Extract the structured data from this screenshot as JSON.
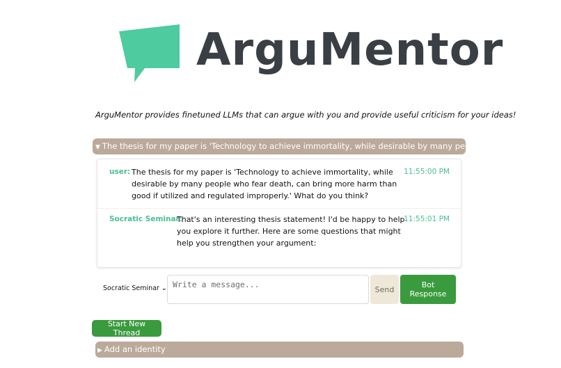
{
  "app": {
    "name": "ArguMentor",
    "tagline": "ArguMentor provides finetuned LLMs that can argue with you and provide useful criticism for your ideas!",
    "brand_color": "#4ecb9f",
    "text_color": "#3a3f45"
  },
  "thread": {
    "toggle_icon": "▼",
    "title": "The thesis for my paper is 'Technology to achieve immortality, while desirable by many people who fe..."
  },
  "messages": [
    {
      "sender": "user:",
      "text": "The thesis for my paper is 'Technology to achieve immortality, while desirable by many people who fear death, can bring more harm than good if utilized and regulated improperly.' What do you think?",
      "time": "11:55:00 PM"
    },
    {
      "sender": "Socratic Seminar:",
      "text": "That's an interesting thesis statement! I'd be happy to help you explore it further. Here are some questions that might help you strengthen your argument:",
      "time": "11:55:01 PM"
    }
  ],
  "composer": {
    "persona": "Socratic Seminar",
    "chevron_icon": "⌄",
    "placeholder": "Write a message...",
    "send_label": "Send",
    "bot_response_label": "Bot Response"
  },
  "actions": {
    "new_thread_label": "Start New Thread",
    "identity_toggle_icon": "▶",
    "identity_label": "Add an identity"
  },
  "colors": {
    "accent_green": "#3a9b3e",
    "disclosure_bar": "#bba99a",
    "sender_green": "#4bbf8f",
    "send_button": "#efe8d8"
  }
}
